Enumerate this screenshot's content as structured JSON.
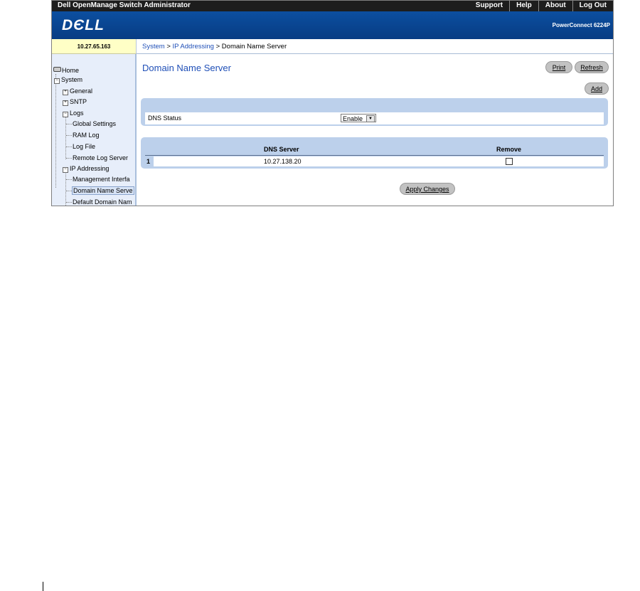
{
  "topbar": {
    "app_title": "Dell OpenManage Switch Administrator",
    "links": [
      "Support",
      "Help",
      "About",
      "Log Out"
    ]
  },
  "banner": {
    "logo": "DЄLL",
    "model": "PowerConnect 6224P"
  },
  "ip_address": "10.27.65.163",
  "breadcrumb": {
    "system": "System",
    "sep1": " > ",
    "ip_addressing": "IP Addressing",
    "sep2": " > ",
    "current": "Domain Name Server"
  },
  "tree": {
    "home": "Home",
    "system": "System",
    "general": "General",
    "sntp": "SNTP",
    "logs": "Logs",
    "global_settings": "Global Settings",
    "ram_log": "RAM Log",
    "log_file": "Log File",
    "remote_log_server": "Remote Log Server",
    "ip_addressing": "IP Addressing",
    "management_interface": "Management Interfa",
    "domain_name_server": "Domain Name Serve",
    "default_domain_name": "Default Domain Nam"
  },
  "page": {
    "title": "Domain Name Server",
    "print_label": "Print",
    "refresh_label": "Refresh",
    "add_label": "Add",
    "dns_status_label": "DNS Status",
    "dns_status_value": "Enable",
    "col_dns_server": "DNS Server",
    "col_remove": "Remove",
    "row_index": "1",
    "row_dns_server": "10.27.138.20",
    "apply_label": "Apply Changes"
  }
}
